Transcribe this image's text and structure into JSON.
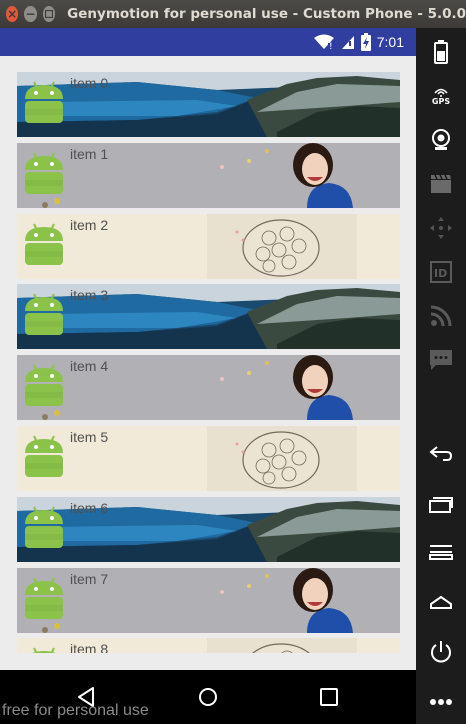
{
  "window": {
    "title": "Genymotion for personal use - Custom Phone - 5.0.0"
  },
  "status_bar": {
    "time": "7:01",
    "color": "#303f9f"
  },
  "list": {
    "items": [
      {
        "label": "item 0",
        "theme": "lake"
      },
      {
        "label": "item 1",
        "theme": "woman"
      },
      {
        "label": "item 2",
        "theme": "flower"
      },
      {
        "label": "item 3",
        "theme": "lake"
      },
      {
        "label": "item 4",
        "theme": "woman"
      },
      {
        "label": "item 5",
        "theme": "flower"
      },
      {
        "label": "item 6",
        "theme": "lake"
      },
      {
        "label": "item 7",
        "theme": "woman"
      },
      {
        "label": "item 8",
        "theme": "flower"
      }
    ]
  },
  "nav_bar": {
    "buttons": [
      "back-icon",
      "home-icon",
      "recents-icon"
    ]
  },
  "watermark": "free for personal use",
  "toolbar": {
    "tools": [
      "battery-icon",
      "gps-icon",
      "camera-icon",
      "clapperboard-icon",
      "dpad-icon",
      "id-icon",
      "rss-icon",
      "chat-icon",
      "back-arrow-icon",
      "recents-icon",
      "menu-icon",
      "home-icon",
      "power-icon",
      "more-icon"
    ],
    "gps_label": "GPS"
  }
}
